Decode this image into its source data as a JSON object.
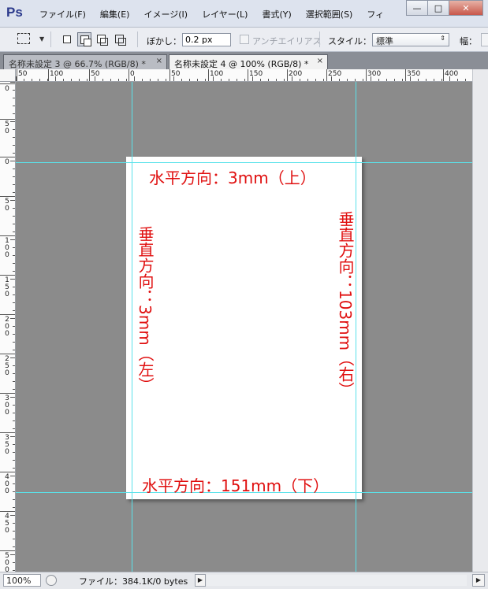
{
  "app": {
    "logo": "Ps",
    "menu": [
      "ファイル(F)",
      "編集(E)",
      "イメージ(I)",
      "レイヤー(L)",
      "書式(Y)",
      "選択範囲(S)",
      "フィ"
    ],
    "window_controls": {
      "minimize": "—",
      "maximize": "□",
      "close": "✕"
    }
  },
  "options": {
    "feather_label": "ぼかし：",
    "feather_value": "0.2 px",
    "antialias_label": "アンチエイリアス",
    "style_label": "スタイル：",
    "style_value": "標準",
    "width_label": "幅："
  },
  "tabs": [
    {
      "title": "名称未設定 3 @ 66.7% (RGB/8) *",
      "active": false
    },
    {
      "title": "名称未設定 4 @ 100% (RGB/8) *",
      "active": true
    }
  ],
  "tab_close": "×",
  "ruler": {
    "top_labels": [
      "50",
      "100",
      "50",
      "0",
      "50",
      "100",
      "150",
      "200",
      "250",
      "300",
      "350",
      "400"
    ],
    "left_labels": [
      "0",
      "50",
      "0",
      "50",
      "100",
      "150",
      "200",
      "250",
      "300",
      "350",
      "400",
      "450",
      "500"
    ]
  },
  "annotations": {
    "top": "水平方向：3mm（上）",
    "bottom": "水平方向：151mm（下）",
    "left": "垂直方向：3mm（左）",
    "right": "垂直方向：103mm（右）"
  },
  "colors": {
    "guide": "#5ae2ea",
    "annotation": "#e01010",
    "canvas_bg": "#8b8b8b"
  },
  "status": {
    "zoom": "100%",
    "file_info": "ファイル：384.1K/0 bytes"
  }
}
